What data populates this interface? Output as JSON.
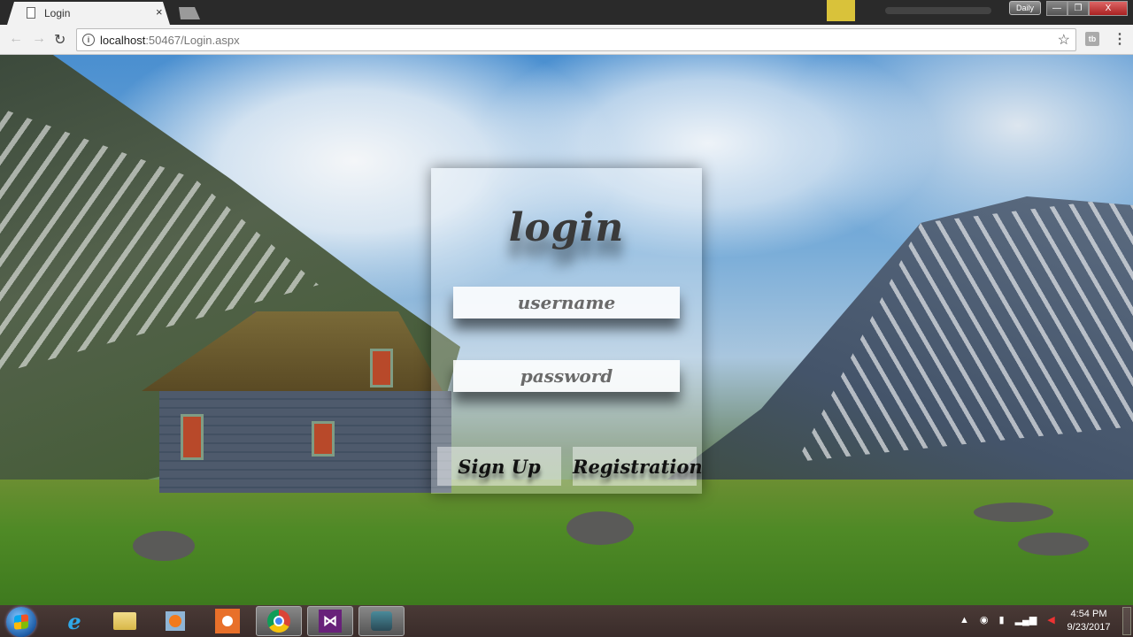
{
  "browser": {
    "tab": {
      "title": "Login",
      "close": "×",
      "icon": "page-icon"
    },
    "url": {
      "host": "localhost",
      "rest": ":50467/Login.aspx"
    },
    "toolbar": {
      "back": "←",
      "forward": "→",
      "reload": "↻",
      "info": "i",
      "star": "☆",
      "extension": "tb",
      "menu": "⋮"
    },
    "window": {
      "daily_label": "Daily",
      "minimize": "—",
      "restore": "❐",
      "close": "X"
    }
  },
  "login": {
    "title": "login",
    "username_placeholder": "username",
    "password_placeholder": "password",
    "signup_label": "Sign Up",
    "registration_label": "Registration"
  },
  "taskbar": {
    "items": [
      "start",
      "internet-explorer",
      "file-explorer",
      "media-player",
      "screen-recorder",
      "chrome",
      "visual-studio",
      "audio-tool"
    ],
    "vs_glyph": "⋈",
    "ie_glyph": "e",
    "tray": {
      "arrow": "▲",
      "icons": [
        "record-icon",
        "power-icon",
        "signal-icon",
        "volume-muted-icon"
      ]
    },
    "clock": {
      "time": "4:54 PM",
      "date": "9/23/2017"
    }
  }
}
